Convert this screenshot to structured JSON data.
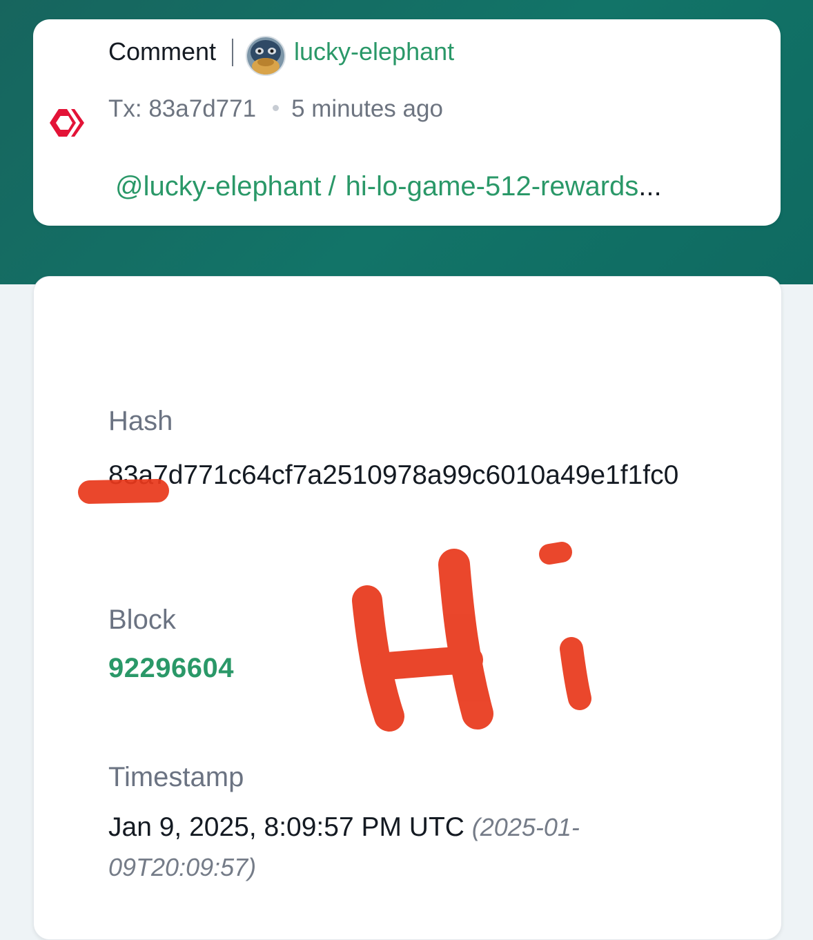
{
  "operation": {
    "type_label": "Comment",
    "author": "lucky-elephant",
    "tx_label": "Tx: 83a7d771",
    "time_ago": "5 minutes ago",
    "permlink_author": "@lucky-elephant",
    "permlink_separator": "/",
    "permlink_slug": "hi-lo-game-512-rewards",
    "permlink_ellipsis": "..."
  },
  "details": {
    "hash_label": "Hash",
    "hash_value": "83a7d771c64cf7a2510978a99c6010a49e1f1fc0",
    "block_label": "Block",
    "block_value": "92296604",
    "timestamp_label": "Timestamp",
    "timestamp_value": "Jan 9, 2025, 8:09:57 PM UTC",
    "timestamp_iso": "(2025-01-09T20:09:57)"
  },
  "annotation": {
    "handwritten_text": "Hi"
  },
  "colors": {
    "header_band": "#127468",
    "accent_green": "#2a9868",
    "hive_red": "#e31337",
    "scribble_red": "#e8391c"
  },
  "icons": {
    "hive": "hive-logo-icon",
    "avatar": "user-avatar"
  }
}
